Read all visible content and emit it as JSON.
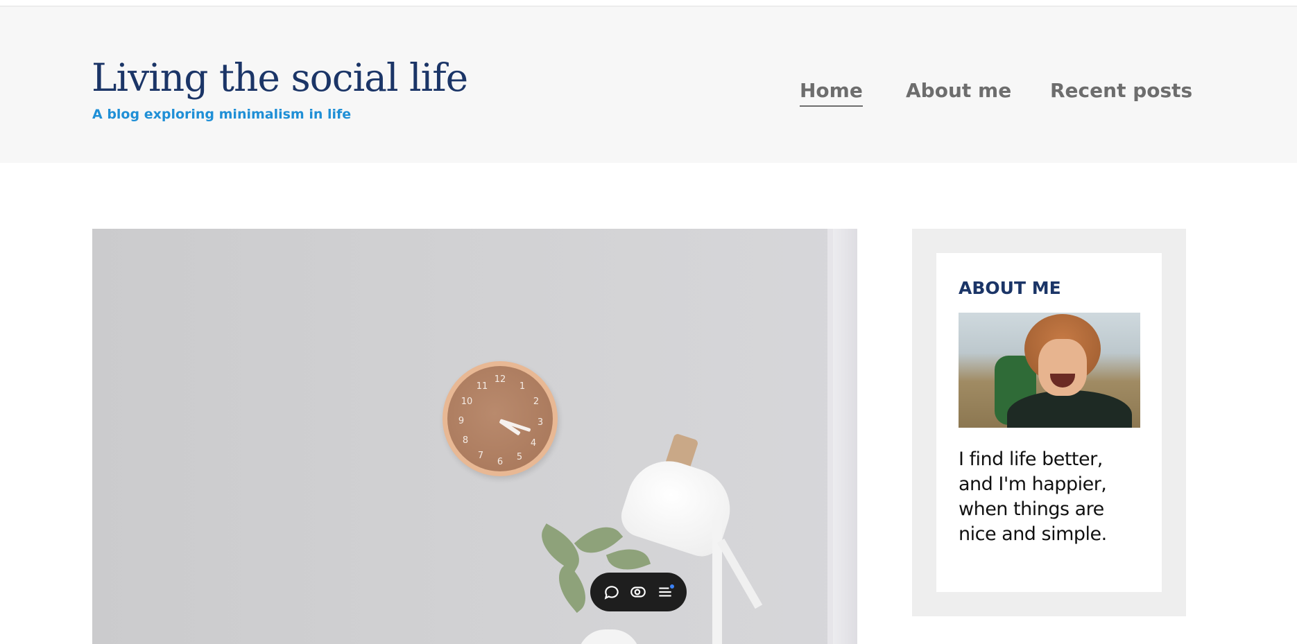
{
  "header": {
    "title": "Living the social life",
    "tagline": "A blog exploring minimalism in life"
  },
  "nav": {
    "items": [
      {
        "label": "Home",
        "active": true
      },
      {
        "label": "About me",
        "active": false
      },
      {
        "label": "Recent posts",
        "active": false
      }
    ]
  },
  "hero": {
    "clock_numbers": [
      "12",
      "1",
      "2",
      "3",
      "4",
      "5",
      "6",
      "7",
      "8",
      "9",
      "10",
      "11"
    ]
  },
  "toolbar": {
    "icons": [
      "comment-icon",
      "eye-icon",
      "menu-icon"
    ],
    "notification_color": "#3b82f6"
  },
  "sidebar": {
    "widget_title": "ABOUT ME",
    "widget_text": "I find life better, and I'm happier, when things are nice and simple."
  },
  "colors": {
    "title": "#1b3567",
    "tagline": "#1f8fd6",
    "nav": "#6d6d6d",
    "header_bg": "#f7f7f7",
    "sidebar_bg": "#eeeeee"
  }
}
